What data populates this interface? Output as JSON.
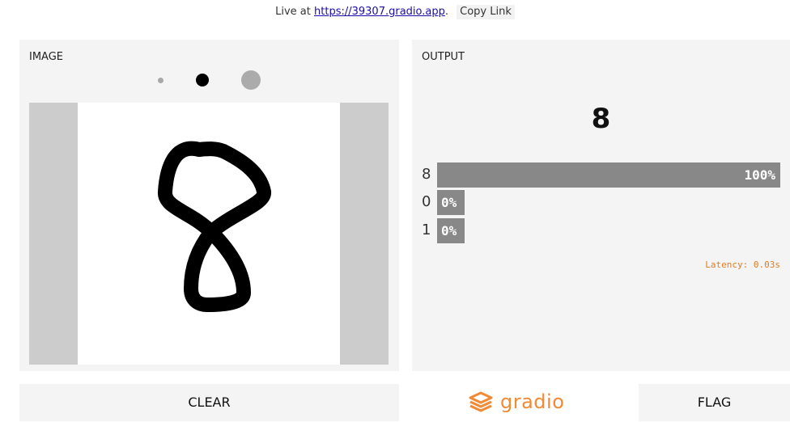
{
  "topbar": {
    "prefix": "Live at",
    "link": "https://39307.gradio.app",
    "suffix": ".",
    "copy_label": "Copy Link"
  },
  "input": {
    "title": "IMAGE",
    "brush_sizes": [
      "small",
      "medium",
      "large"
    ],
    "selected_brush": "medium"
  },
  "output": {
    "title": "OUTPUT",
    "label": "8",
    "confidences": [
      {
        "label": "8",
        "percent": "100%",
        "value": 1.0
      },
      {
        "label": "0",
        "percent": "0%",
        "value": 0.0
      },
      {
        "label": "1",
        "percent": "0%",
        "value": 0.0
      }
    ],
    "latency": "Latency: 0.03s"
  },
  "buttons": {
    "clear": "CLEAR",
    "flag": "FLAG"
  },
  "brand": {
    "name": "gradio",
    "color": "#f08a36"
  },
  "colors": {
    "bar": "#888888",
    "latency": "#e07c24"
  }
}
